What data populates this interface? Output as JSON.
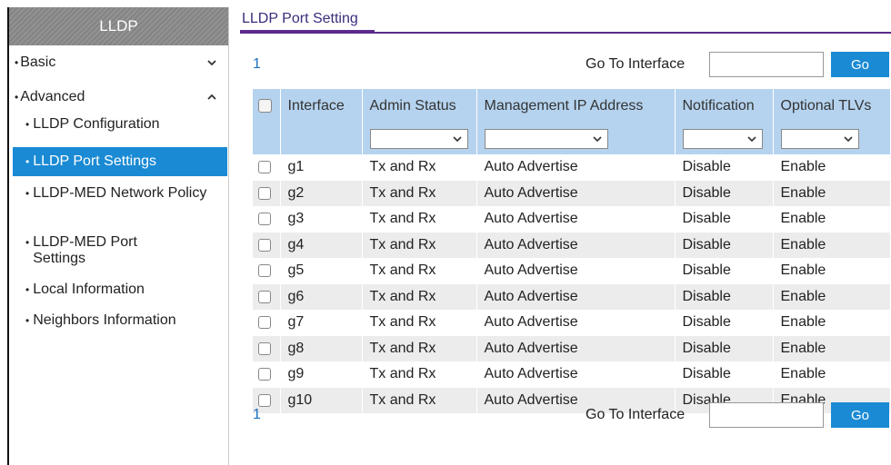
{
  "sidebar": {
    "header": "LLDP",
    "sections": [
      {
        "label": "Basic",
        "expanded": false
      },
      {
        "label": "Advanced",
        "expanded": true
      }
    ],
    "items": [
      {
        "label": "LLDP Configuration"
      },
      {
        "label": "LLDP Port Settings",
        "active": true
      },
      {
        "label": "LLDP-MED Network Policy"
      },
      {
        "label": "LLDP-MED Port Settings"
      },
      {
        "label": "Local Information"
      },
      {
        "label": "Neighbors Information"
      }
    ]
  },
  "main": {
    "title": "LLDP Port Setting",
    "pager": {
      "page": "1",
      "goto_label": "Go To Interface",
      "go_label": "Go",
      "goto_value": ""
    },
    "columns": [
      "Interface",
      "Admin Status",
      "Management IP Address",
      "Notification",
      "Optional TLVs"
    ],
    "rows": [
      [
        "g1",
        "Tx and Rx",
        "Auto Advertise",
        "Disable",
        "Enable"
      ],
      [
        "g2",
        "Tx and Rx",
        "Auto Advertise",
        "Disable",
        "Enable"
      ],
      [
        "g3",
        "Tx and Rx",
        "Auto Advertise",
        "Disable",
        "Enable"
      ],
      [
        "g4",
        "Tx and Rx",
        "Auto Advertise",
        "Disable",
        "Enable"
      ],
      [
        "g5",
        "Tx and Rx",
        "Auto Advertise",
        "Disable",
        "Enable"
      ],
      [
        "g6",
        "Tx and Rx",
        "Auto Advertise",
        "Disable",
        "Enable"
      ],
      [
        "g7",
        "Tx and Rx",
        "Auto Advertise",
        "Disable",
        "Enable"
      ],
      [
        "g8",
        "Tx and Rx",
        "Auto Advertise",
        "Disable",
        "Enable"
      ],
      [
        "g9",
        "Tx and Rx",
        "Auto Advertise",
        "Disable",
        "Enable"
      ],
      [
        "g10",
        "Tx and Rx",
        "Auto Advertise",
        "Disable",
        "Enable"
      ]
    ]
  },
  "colors": {
    "accent": "#1a8ad4",
    "header_bg": "#b5d3ef",
    "title": "#3b2d7a",
    "rule": "#5b2a8c",
    "sidebar_header": "#8b8b8b"
  }
}
